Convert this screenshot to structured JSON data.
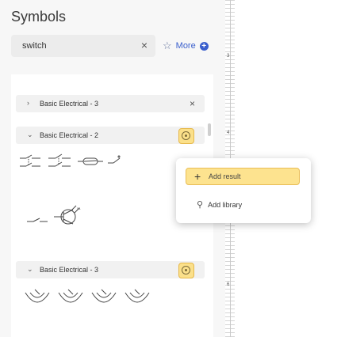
{
  "panel": {
    "title": "Symbols",
    "search": {
      "value": "switch",
      "clear_icon": "close-icon"
    },
    "more": {
      "label": "More",
      "star_icon": "star-icon",
      "add_icon": "plus-circle-icon"
    }
  },
  "library_list": {
    "collapsed": {
      "label": "Basic Electrical - 3",
      "chevron": "chevron-right-icon",
      "close_icon": "close-icon"
    },
    "expanded_1": {
      "label": "Basic Electrical - 2",
      "chevron": "chevron-down-icon",
      "badge_icon": "library-settings-icon"
    },
    "expanded_2": {
      "label": "Basic Electrical - 3",
      "chevron": "chevron-down-icon",
      "badge_icon": "library-settings-icon"
    }
  },
  "ruler": {
    "labels": [
      "3",
      "4",
      "5",
      "6"
    ]
  },
  "context_menu": {
    "add_result": {
      "icon": "plus-icon",
      "label": "Add result"
    },
    "add_library": {
      "icon": "pin-icon",
      "label": "Add library"
    }
  },
  "colors": {
    "accent": "#3a5fcd",
    "badge_fill": "#fbe08a",
    "badge_border": "#e6b84a"
  }
}
